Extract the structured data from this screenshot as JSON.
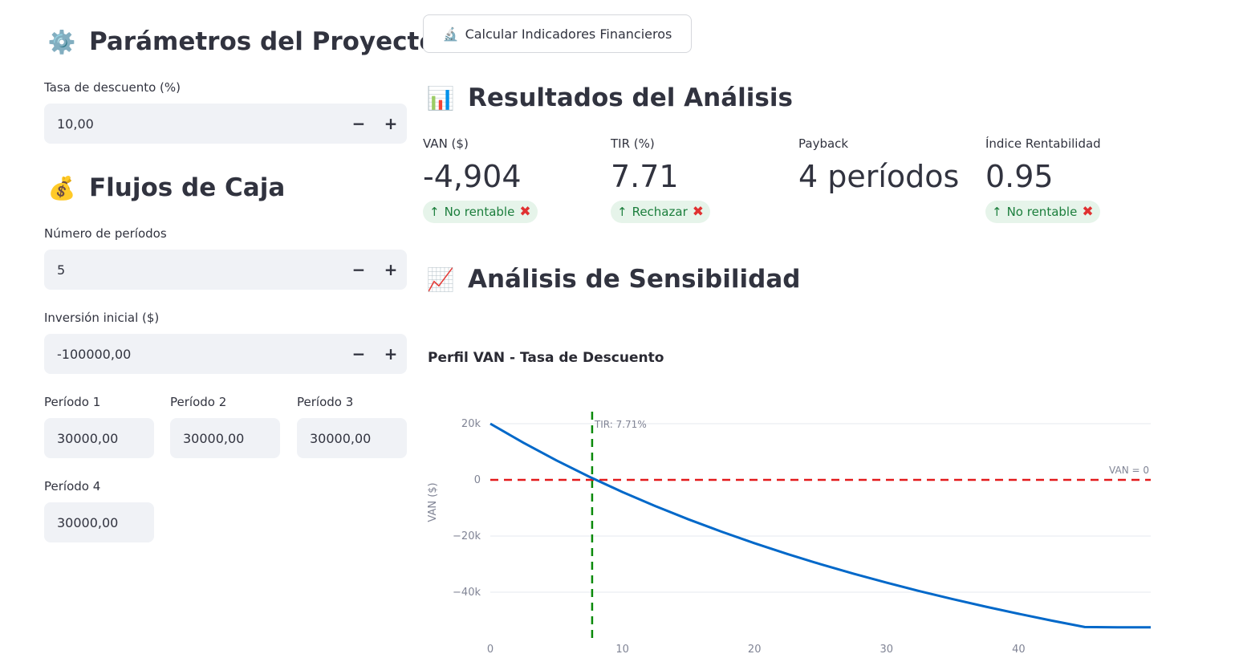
{
  "sidebar": {
    "params_title": "Parámetros del Proyecto",
    "params_emoji": "⚙️",
    "discount_label": "Tasa de descuento (%)",
    "discount_value": "10,00",
    "cash_title": "Flujos de Caja",
    "cash_emoji": "💰",
    "periods_label": "Número de períodos",
    "periods_value": "5",
    "investment_label": "Inversión inicial ($)",
    "investment_value": "-100000,00",
    "minus": "−",
    "plus": "+",
    "period_flows": [
      {
        "label": "Período 1",
        "value": "30000,00"
      },
      {
        "label": "Período 2",
        "value": "30000,00"
      },
      {
        "label": "Período 3",
        "value": "30000,00"
      },
      {
        "label": "Período 4",
        "value": "30000,00"
      }
    ]
  },
  "main": {
    "calc_button": "Calcular Indicadores Financieros",
    "calc_icon": "🔬",
    "results_title": "Resultados del Análisis",
    "results_emoji": "📊",
    "metrics": [
      {
        "label": "VAN ($)",
        "value": "-4,904",
        "delta": "No rentable",
        "arrow": "↑",
        "x": "✖"
      },
      {
        "label": "TIR (%)",
        "value": "7.71",
        "delta": "Rechazar",
        "arrow": "↑",
        "x": "✖"
      },
      {
        "label": "Payback",
        "value": "4 períodos",
        "delta": "",
        "arrow": "",
        "x": ""
      },
      {
        "label": "Índice Rentabilidad",
        "value": "0.95",
        "delta": "No rentable",
        "arrow": "↑",
        "x": "✖"
      }
    ],
    "sensitivity_title": "Análisis de Sensibilidad",
    "sensitivity_emoji": "📈"
  },
  "chart_data": {
    "type": "line",
    "title": "Perfil VAN - Tasa de Descuento",
    "xlabel": "",
    "ylabel": "VAN ($)",
    "xlim": [
      0,
      50
    ],
    "ylim": [
      -55000,
      23000
    ],
    "x_ticks": [
      0,
      10,
      20,
      30,
      40
    ],
    "x_tick_labels": [
      "0",
      "10",
      "20",
      "30",
      "40"
    ],
    "y_ticks": [
      20000,
      0,
      -20000,
      -40000
    ],
    "y_tick_labels": [
      "20k",
      "0",
      "−20k",
      "−40k"
    ],
    "grid": true,
    "series": [
      {
        "color": "#0068c9",
        "x": [
          0,
          2.5,
          5,
          7.5,
          10,
          12.5,
          15,
          17.5,
          20,
          22.5,
          25,
          27.5,
          30,
          32.5,
          35,
          37.5,
          40,
          42.5,
          45,
          47.5,
          50
        ],
        "y": [
          20000,
          13222,
          6943,
          1116,
          -4303,
          -9346,
          -14047,
          -18439,
          -22550,
          -26402,
          -30016,
          -33414,
          -36612,
          -39626,
          -42469,
          -45156,
          -47699,
          -50107,
          -52389,
          -54555,
          -56613
        ]
      }
    ],
    "annotations": [
      {
        "text": "TIR: 7.71%",
        "type": "vline",
        "x": 7.71,
        "color": "#0a8a0a"
      },
      {
        "text": "VAN = 0",
        "type": "hline",
        "y": 0,
        "color": "#e31a1c"
      }
    ]
  }
}
